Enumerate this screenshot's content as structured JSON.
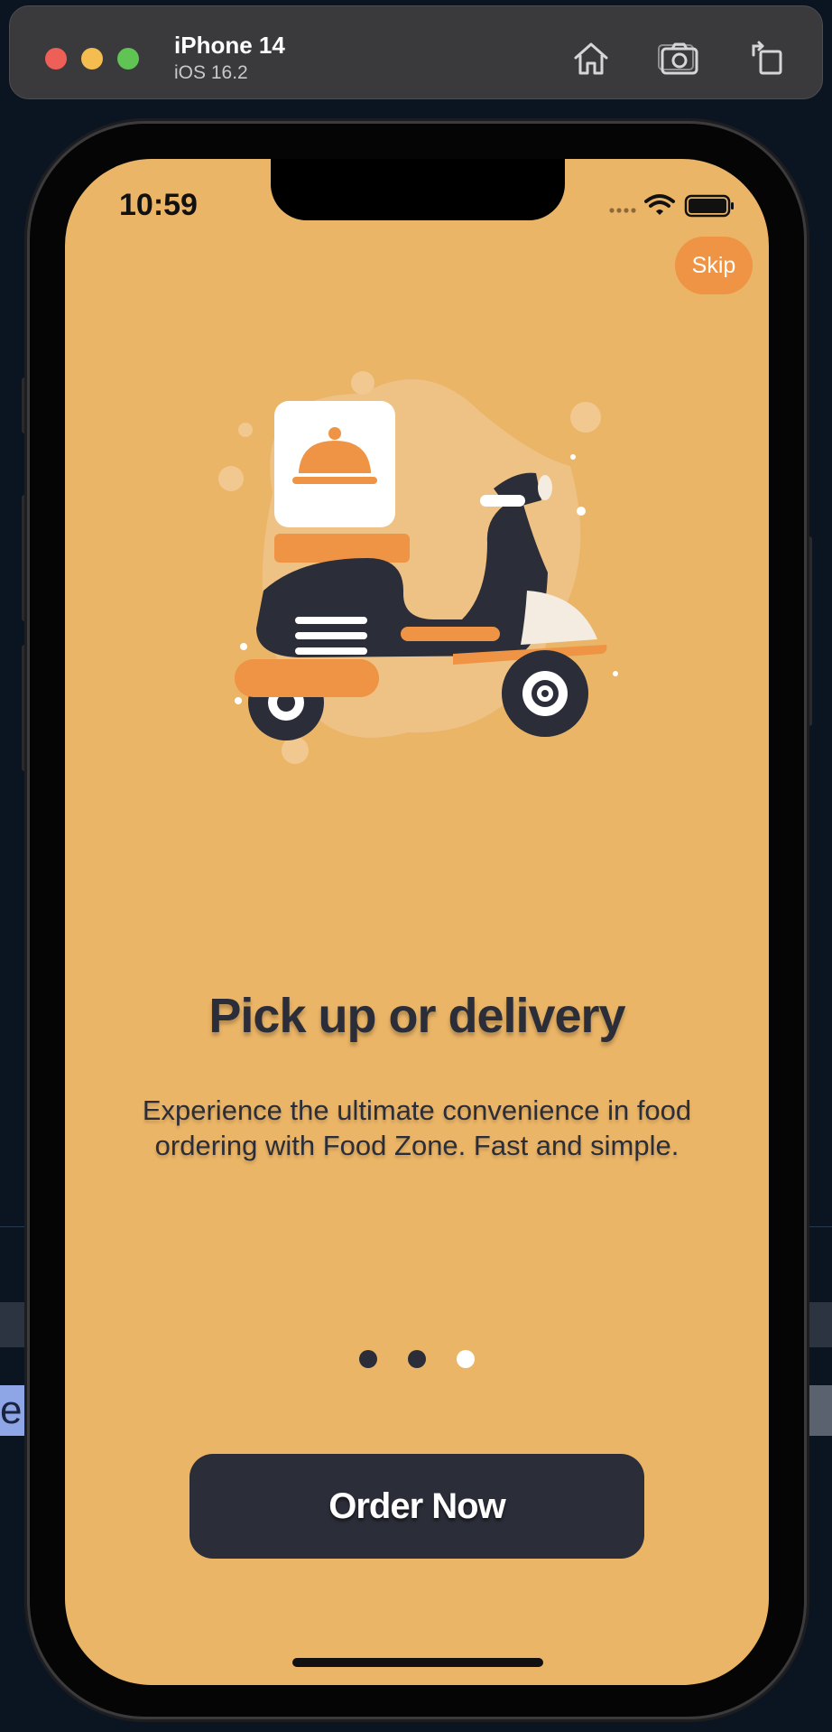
{
  "simulator": {
    "device_name": "iPhone 14",
    "os_version": "iOS 16.2",
    "toolbar_icons": [
      "home-icon",
      "screenshot-icon",
      "rotate-icon"
    ]
  },
  "background": {
    "tag_text": "e"
  },
  "status_bar": {
    "time": "10:59",
    "icons": [
      "cellular-dots-icon",
      "wifi-icon",
      "battery-icon"
    ]
  },
  "onboarding": {
    "skip_label": "Skip",
    "title": "Pick up or delivery",
    "description": "Experience the ultimate convenience in food ordering with Food Zone. Fast and simple.",
    "page_count": 3,
    "active_page_index": 2,
    "cta_label": "Order Now",
    "illustration": "delivery-scooter-illustration"
  },
  "colors": {
    "screen_bg": "#ebb567",
    "accent": "#ee9444",
    "dark": "#2b2d38",
    "active_dot": "#ffffff"
  }
}
